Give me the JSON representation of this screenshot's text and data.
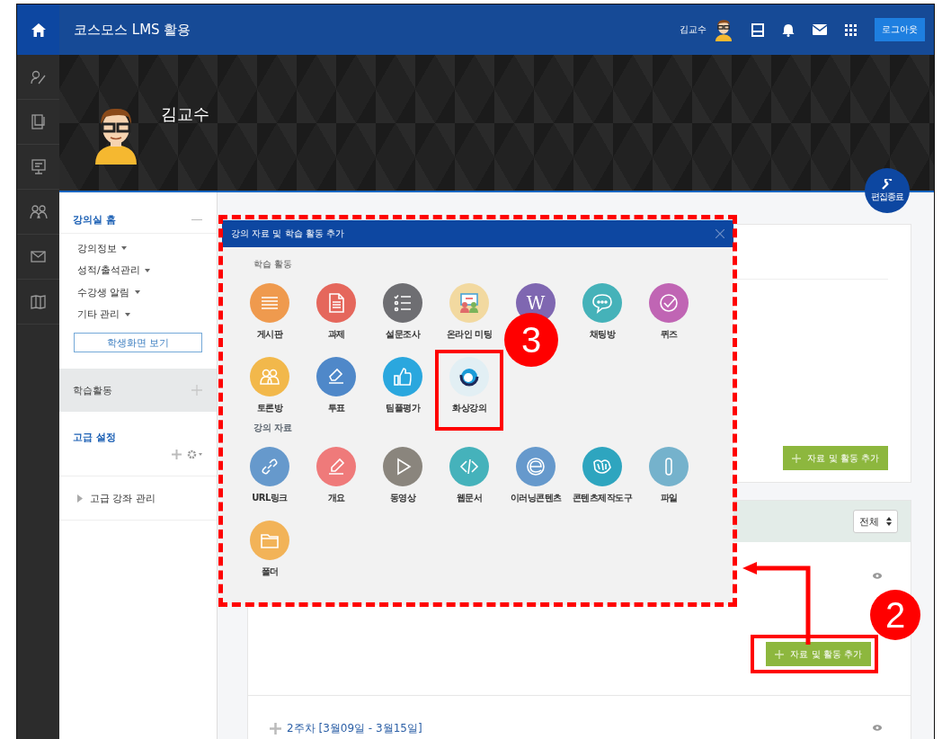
{
  "topbar": {
    "title": "코스모스 LMS 활용",
    "user_name": "김교수",
    "logout": "로그아웃"
  },
  "banner": {
    "name": "김교수"
  },
  "edit_button": {
    "label": "편집종료"
  },
  "left_panel": {
    "home": {
      "title": "강의실 홈",
      "menu": [
        {
          "label": "강의정보"
        },
        {
          "label": "성적/출석관리"
        },
        {
          "label": "수강생 알림"
        },
        {
          "label": "기타 관리"
        }
      ],
      "student_view_button": "학생화면 보기"
    },
    "activities": {
      "title": "학습활동"
    },
    "advanced": {
      "title": "고급 설정",
      "items": [
        {
          "label": "고급 강좌 관리"
        }
      ]
    }
  },
  "main": {
    "add_button_top": "자료 및 활동 추가",
    "filter_select": "전체",
    "add_button_bottom": "자료 및 활동 추가",
    "week": {
      "title": "2주차 [3월09일 - 3월15일]"
    }
  },
  "modal": {
    "title": "강의 자료 및 학습 활동 추가",
    "sections": [
      {
        "title": "학습 활동",
        "items": [
          {
            "kind": "board",
            "label": "게시판",
            "color": "#ef9a4e",
            "highlighted": false
          },
          {
            "kind": "assignment",
            "label": "과제",
            "color": "#e5675c",
            "highlighted": false
          },
          {
            "kind": "survey",
            "label": "설문조사",
            "color": "#6e6e72",
            "highlighted": false
          },
          {
            "kind": "meeting",
            "label": "온라인 미팅",
            "color": "#f2d9a0",
            "highlighted": false
          },
          {
            "kind": "wiki",
            "glyph": "W",
            "color": "#7f67b1",
            "highlighted": false
          },
          {
            "kind": "chat",
            "label": "채팅방",
            "color": "#45b2b9",
            "highlighted": false
          },
          {
            "kind": "quiz",
            "label": "퀴즈",
            "color": "#c065b4",
            "highlighted": false
          },
          {
            "kind": "forum",
            "label": "토론방",
            "color": "#f2b84b",
            "highlighted": false
          },
          {
            "kind": "vote",
            "label": "투표",
            "color": "#4f88c9",
            "highlighted": false
          },
          {
            "kind": "peer",
            "label": "팀플평가",
            "color": "#2aa7de",
            "highlighted": false
          },
          {
            "kind": "video_class",
            "label": "화상강의",
            "color": "#e2eff4",
            "highlighted": true
          }
        ]
      },
      {
        "title": "강의 자료",
        "items": [
          {
            "kind": "url",
            "label": "URL링크",
            "color": "#6699cc",
            "highlighted": false
          },
          {
            "kind": "summary",
            "label": "개요",
            "color": "#ef7a7a",
            "highlighted": false
          },
          {
            "kind": "video",
            "label": "동영상",
            "color": "#8a857d",
            "highlighted": false
          },
          {
            "kind": "web",
            "label": "웹문서",
            "color": "#45b2bb",
            "highlighted": false
          },
          {
            "kind": "elearning",
            "label": "이러닝콘텐츠",
            "color": "#6699cc",
            "highlighted": false
          },
          {
            "kind": "authoring",
            "label": "콘텐츠제작도구",
            "color": "#2ea5bf",
            "highlighted": false
          },
          {
            "kind": "file",
            "label": "파일",
            "color": "#75b2cc",
            "highlighted": false
          },
          {
            "kind": "folder",
            "label": "폴더",
            "color": "#f2b358",
            "highlighted": false
          }
        ]
      }
    ]
  },
  "annotations": [
    {
      "label": "3"
    },
    {
      "label": "2"
    }
  ]
}
